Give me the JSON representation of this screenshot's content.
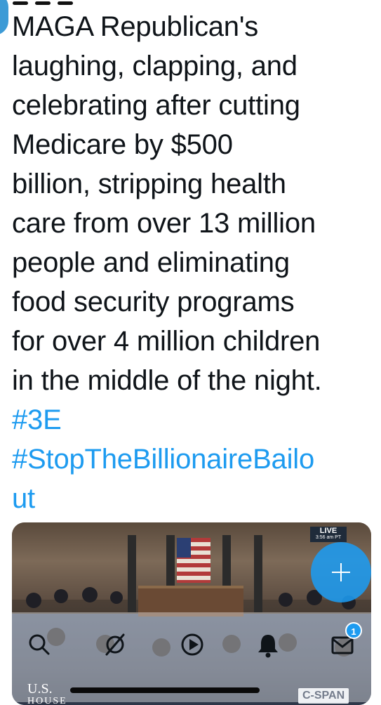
{
  "tweet": {
    "lines": [
      "MAGA Republican's",
      "laughing, clapping, and",
      "celebrating after cutting",
      "Medicare by $500",
      "billion, stripping health",
      "care from over 13 million",
      "people and eliminating",
      "food security programs",
      "for over 4 million children",
      "in the middle of the night."
    ],
    "hashtags": [
      "#3E",
      "#StopTheBillionaireBailo",
      "ut"
    ]
  },
  "video": {
    "live_label": "LIVE",
    "time_label": "3:56 am PT",
    "watermark_left_line1": "U.S.",
    "watermark_left_line2": "HOUSE",
    "watermark_right": "C-SPAN"
  },
  "fab": {
    "icon": "plus-icon"
  },
  "bottom_nav": {
    "items": [
      {
        "icon": "search-icon"
      },
      {
        "icon": "spaces-icon"
      },
      {
        "icon": "play-icon"
      },
      {
        "icon": "bell-icon"
      },
      {
        "icon": "mail-icon"
      }
    ],
    "mail_badge": "1"
  },
  "colors": {
    "text": "#0f1419",
    "hashtag": "#1d9bf0",
    "accent": "#1d9bf0"
  }
}
